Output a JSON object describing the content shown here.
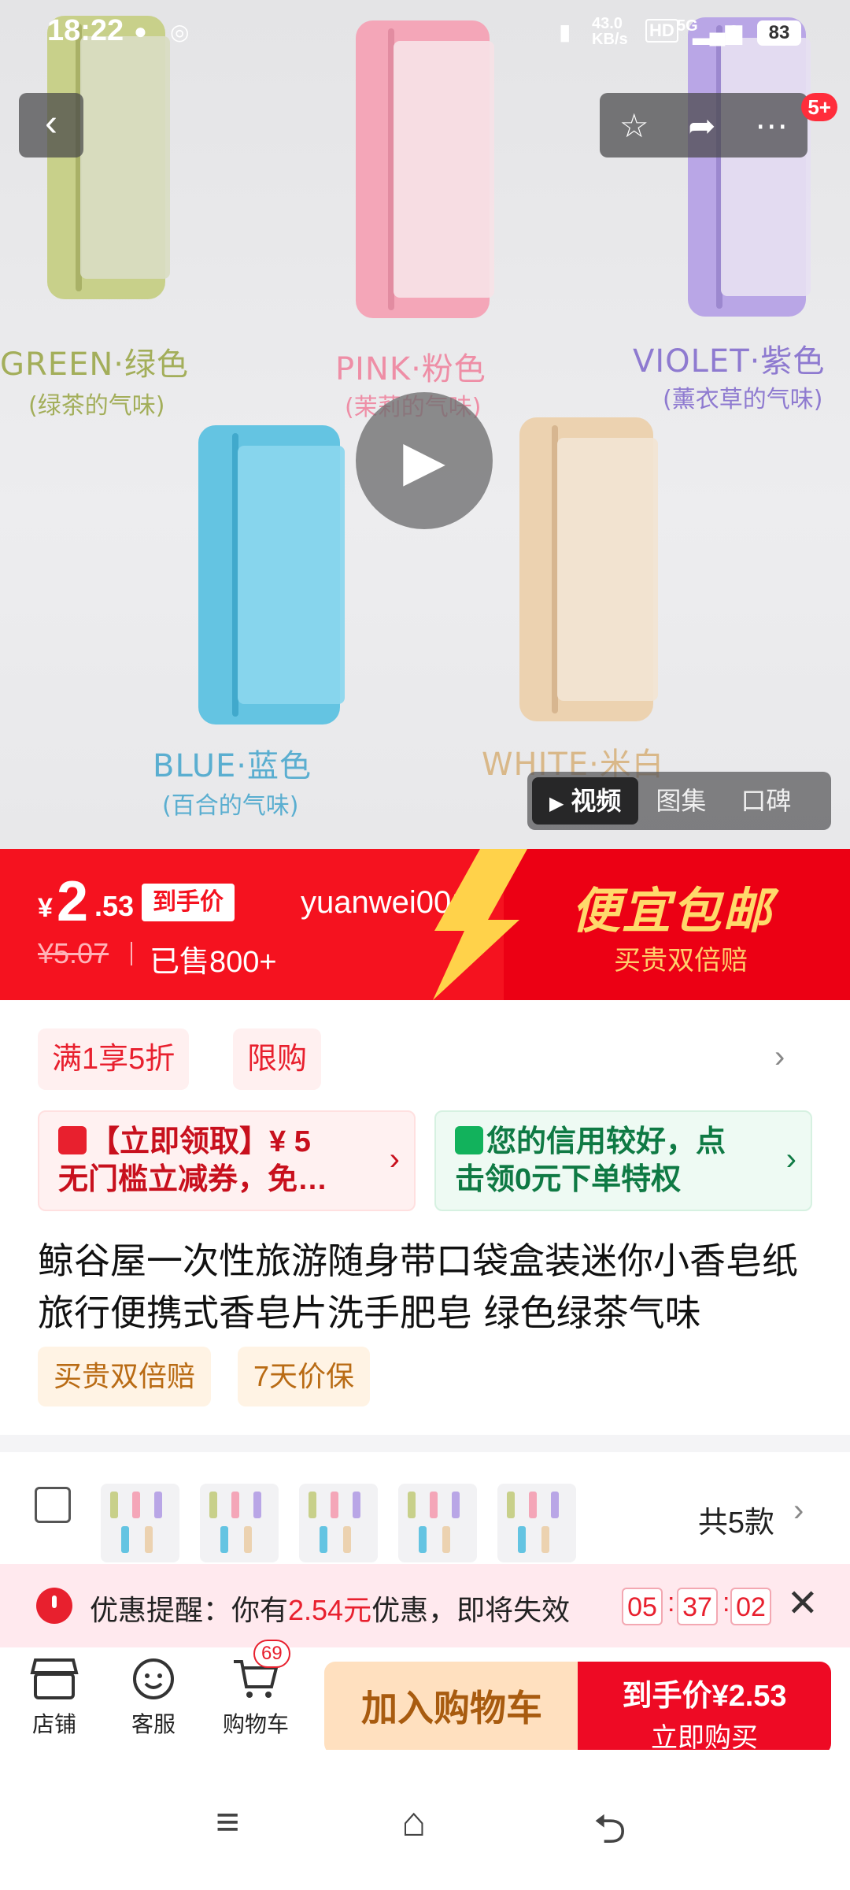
{
  "status_bar": {
    "time": "18:22",
    "network_speed": "43.0 KB/s",
    "hd": "HD",
    "signal": "5G",
    "battery": "83"
  },
  "hero": {
    "soaps": [
      {
        "label": "GREEN·绿色",
        "scent": "(绿茶的气味)",
        "color": "#c8d08a"
      },
      {
        "label": "PINK·粉色",
        "scent": "(茉莉的气味)",
        "color": "#f4a6b8"
      },
      {
        "label": "VIOLET·紫色",
        "scent": "(薰衣草的气味)",
        "color": "#b9a6e6"
      },
      {
        "label": "BLUE·蓝色",
        "scent": "(百合的气味)",
        "color": "#64c4e2"
      },
      {
        "label": "WHITE·米白",
        "scent": "",
        "color": "#ecd2b0"
      }
    ],
    "cart_count_badge": "5+",
    "media_tabs": [
      {
        "label": "视频",
        "active": true
      },
      {
        "label": "图集",
        "active": false
      },
      {
        "label": "口碑",
        "active": false
      }
    ]
  },
  "price_banner": {
    "currency": "¥",
    "price_int": "2",
    "price_dec": ".53",
    "final_price_tag": "到手价",
    "username": "yuanwei001",
    "original_price": "¥5.07",
    "sold": "已售800+",
    "promo_title": "便宜包邮",
    "promo_subtitle": "买贵双倍赔"
  },
  "tags": [
    "满1享5折",
    "限购"
  ],
  "coupons": {
    "red": {
      "line1": "【立即领取】¥ 5",
      "line2": "无门槛立减券，免…"
    },
    "green": {
      "line1": "您的信用较好，点",
      "line2": "击领0元下单特权"
    }
  },
  "product": {
    "title": "鲸谷屋一次性旅游随身带口袋盒装迷你小香皂纸旅行便携式香皂片洗手肥皂 绿色绿茶气味",
    "service_tags": [
      "买贵双倍赔",
      "7天价保"
    ]
  },
  "variants": {
    "count_label": "共5款"
  },
  "reminder": {
    "prefix": "优惠提醒：你有",
    "amount": "2.54元",
    "suffix": "优惠，即将失效",
    "timer": [
      "05",
      "37",
      "02"
    ]
  },
  "bottom_bar": {
    "shop": "店铺",
    "service": "客服",
    "cart": "购物车",
    "cart_badge": "69",
    "add_to_cart": "加入购物车",
    "buy_price_label": "到手价¥2.53",
    "buy_now": "立即购买"
  },
  "colors": {
    "brand_red": "#f5121f",
    "buy_red": "#ee0a24",
    "add_cart_bg": "#ffe0bf",
    "promo_gold": "#ffd96b"
  }
}
